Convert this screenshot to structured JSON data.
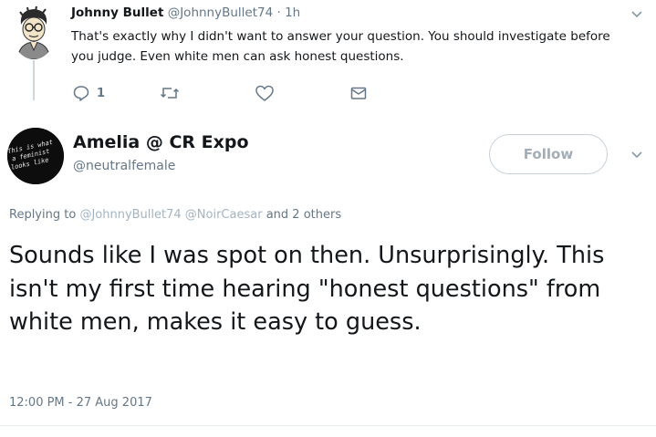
{
  "reply": {
    "name": "Johnny Bullet",
    "handle": "@JohnnyBullet74",
    "separator": "·",
    "time": "1h",
    "text": "That's exactly why I didn't want to answer your question. You should investigate before you judge. Even white men can ask honest questions.",
    "reply_count": "1",
    "icons": {
      "reply": "reply-icon",
      "retweet": "retweet-icon",
      "like": "heart-icon",
      "dm": "envelope-icon",
      "menu": "chevron-down-icon"
    }
  },
  "main": {
    "name": "Amelia @ CR Expo",
    "handle": "@neutralfemale",
    "follow_label": "Follow",
    "avatar_text": "This is what a feminist looks like",
    "replying_prefix": "Replying to",
    "replying_users": [
      "@JohnnyBullet74",
      "@NoirCaesar"
    ],
    "replying_suffix": "and 2 others",
    "text": "Sounds like I was spot on then. Unsurprisingly. This isn't my first time hearing \"honest questions\" from white men, makes it easy to guess.",
    "timestamp": "12:00 PM - 27 Aug 2017"
  },
  "colors": {
    "text": "#14171a",
    "secondary": "#657786",
    "link_faded": "#a3b4c2",
    "follow_border": "#c7d0d8",
    "avatar_bg": "#0d0d0d"
  }
}
